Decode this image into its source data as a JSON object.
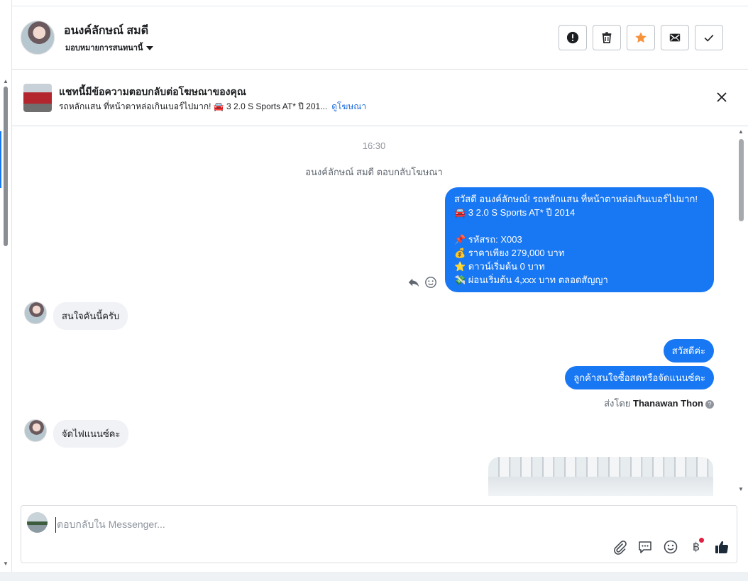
{
  "header": {
    "name": "อนงค์ลักษณ์ สมดี",
    "assign_label": "มอบหมายการสนทนานี้"
  },
  "ad_banner": {
    "title": "แชทนี้มีข้อความตอบกลับต่อโฆษณาของคุณ",
    "description": "รถหลักแสน ที่หน้าตาหล่อเกินเบอร์ไปมาก! 🚘 3 2.0 S Sports AT* ปี 201...",
    "link": "ดูโฆษณา"
  },
  "chat": {
    "timestamp": "16:30",
    "system_note": "อนงค์ลักษณ์ สมดี ตอบกลับโฆษณา",
    "ad_message_lines": [
      "สวัสดี อนงค์ลักษณ์! รถหลักแสน ที่หน้าตาหล่อเกินเบอร์ไปมาก!",
      "🚘 3 2.0 S Sports AT* ปี 2014",
      "",
      "📌 รหัสรถ: X003",
      "💰 ราคาเพียง 279,000 บาท",
      "⭐ ดาวน์เริ่มต้น 0 บาท",
      "💸 ผ่อนเริ่มต้น 4,xxx บาท ตลอดสัญญา"
    ],
    "incoming_1": "สนใจคันนี้ครับ",
    "outgoing_1": "สวัสดีค่ะ",
    "outgoing_2": "ลูกค้าสนใจซื้อสดหรือจัดแนนซ์คะ",
    "sent_by_label": "ส่งโดย",
    "sent_by_name": "Thanawan Thon",
    "incoming_2": "จัดไฟแนนซ์คะ"
  },
  "composer": {
    "placeholder": "ตอบกลับใน Messenger..."
  },
  "icons": {
    "header": [
      "alert-icon",
      "trash-icon",
      "star-icon",
      "mail-icon",
      "check-icon"
    ],
    "composer": [
      "attach-icon",
      "saved-reply-icon",
      "emoji-icon",
      "baht-icon",
      "thumbs-up-icon"
    ]
  },
  "colors": {
    "accent": "#1877f2",
    "star": "#f7923b",
    "link": "#216fdb"
  }
}
